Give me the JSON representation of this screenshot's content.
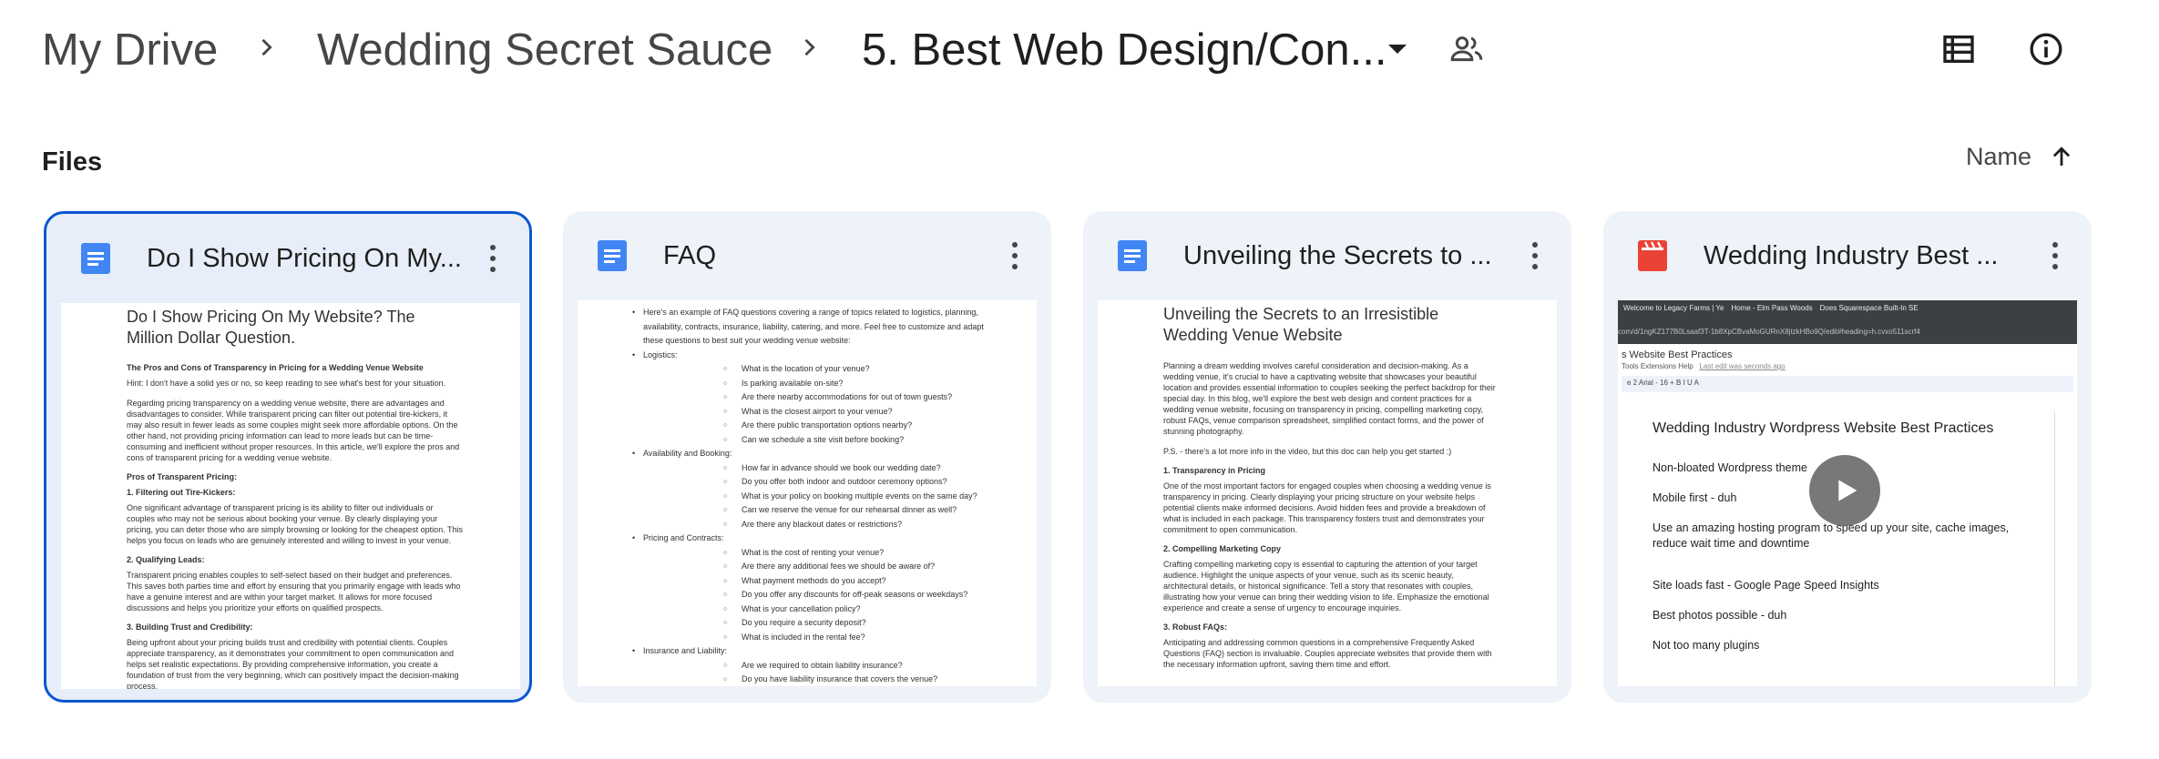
{
  "breadcrumb": {
    "items": [
      "My Drive",
      "Wedding Secret Sauce",
      "5. Best Web Design/Con..."
    ]
  },
  "section": {
    "files_label": "Files",
    "sort_label": "Name"
  },
  "icons": {
    "separator": "chevron-right-icon",
    "dropdown": "arrow-drop-down-icon",
    "shared": "people-icon",
    "list_view": "list-view-icon",
    "info": "info-icon",
    "sort_dir": "arrow-upward-icon",
    "doc": "google-docs-icon",
    "video": "video-clapper-icon",
    "more": "more-vert-icon",
    "play": "play-icon"
  },
  "colors": {
    "docs_blue": "#4285f4",
    "video_red": "#ea4335",
    "selected_border": "#0b57d0",
    "card_bg": "#eef2f9"
  },
  "cards": [
    {
      "title": "Do I Show Pricing On My...",
      "preview": {
        "title": "Do I Show Pricing On My Website? The Million Dollar Question.",
        "blocks": [
          {
            "type": "h",
            "text": "The Pros and Cons of Transparency in Pricing for a Wedding Venue Website"
          },
          {
            "type": "p",
            "text": "Hint: I don't have a solid yes or no, so keep reading to see what's best for your situation."
          },
          {
            "type": "p",
            "text": "Regarding pricing transparency on a wedding venue website, there are advantages and disadvantages to consider. While transparent pricing can filter out potential tire-kickers, it may also result in fewer leads as some couples might seek more affordable options. On the other hand, not providing pricing information can lead to more leads but can be time-consuming and inefficient without proper resources. In this article, we'll explore the pros and cons of transparent pricing for a wedding venue website."
          },
          {
            "type": "h",
            "text": "Pros of Transparent Pricing:"
          },
          {
            "type": "h",
            "text": "1. Filtering out Tire-Kickers:"
          },
          {
            "type": "p",
            "text": "One significant advantage of transparent pricing is its ability to filter out individuals or couples who may not be serious about booking your venue. By clearly displaying your pricing, you can deter those who are simply browsing or looking for the cheapest option. This helps you focus on leads who are genuinely interested and willing to invest in your venue."
          },
          {
            "type": "h",
            "text": "2. Qualifying Leads:"
          },
          {
            "type": "p",
            "text": "Transparent pricing enables couples to self-select based on their budget and preferences. This saves both parties time and effort by ensuring that you primarily engage with leads who have a genuine interest and are within your target market. It allows for more focused discussions and helps you prioritize your efforts on qualified prospects."
          },
          {
            "type": "h",
            "text": "3. Building Trust and Credibility:"
          },
          {
            "type": "p",
            "text": "Being upfront about your pricing builds trust and credibility with potential clients. Couples appreciate transparency, as it demonstrates your commitment to open communication and helps set realistic expectations. By providing comprehensive information, you create a foundation of trust from the very beginning, which can positively impact the decision-making process."
          }
        ]
      }
    },
    {
      "title": "FAQ",
      "preview": {
        "lines": [
          {
            "lvl": 0,
            "text": "Here's an example of FAQ questions covering a range of topics related to logistics, planning, availability, contracts, insurance, liability, catering, and more. Feel free to customize and adapt these questions to best suit your wedding venue website:"
          },
          {
            "lvl": 0,
            "text": "Logistics:"
          },
          {
            "lvl": 1,
            "text": "What is the location of your venue?"
          },
          {
            "lvl": 1,
            "text": "Is parking available on-site?"
          },
          {
            "lvl": 1,
            "text": "Are there nearby accommodations for out of town guests?"
          },
          {
            "lvl": 1,
            "text": "What is the closest airport to your venue?"
          },
          {
            "lvl": 1,
            "text": "Are there public transportation options nearby?"
          },
          {
            "lvl": 1,
            "text": "Can we schedule a site visit before booking?"
          },
          {
            "lvl": 0,
            "text": "Availability and Booking:"
          },
          {
            "lvl": 1,
            "text": "How far in advance should we book our wedding date?"
          },
          {
            "lvl": 1,
            "text": "Do you offer both indoor and outdoor ceremony options?"
          },
          {
            "lvl": 1,
            "text": "What is your policy on booking multiple events on the same day?"
          },
          {
            "lvl": 1,
            "text": "Can we reserve the venue for our rehearsal dinner as well?"
          },
          {
            "lvl": 1,
            "text": "Are there any blackout dates or restrictions?"
          },
          {
            "lvl": 0,
            "text": "Pricing and Contracts:"
          },
          {
            "lvl": 1,
            "text": "What is the cost of renting your venue?"
          },
          {
            "lvl": 1,
            "text": "Are there any additional fees we should be aware of?"
          },
          {
            "lvl": 1,
            "text": "What payment methods do you accept?"
          },
          {
            "lvl": 1,
            "text": "Do you offer any discounts for off-peak seasons or weekdays?"
          },
          {
            "lvl": 1,
            "text": "What is your cancellation policy?"
          },
          {
            "lvl": 1,
            "text": "Do you require a security deposit?"
          },
          {
            "lvl": 1,
            "text": "What is included in the rental fee?"
          },
          {
            "lvl": 0,
            "text": "Insurance and Liability:"
          },
          {
            "lvl": 1,
            "text": "Are we required to obtain liability insurance?"
          },
          {
            "lvl": 1,
            "text": "Do you have liability insurance that covers the venue?"
          }
        ]
      }
    },
    {
      "title": "Unveiling the Secrets to ...",
      "preview": {
        "title": "Unveiling the Secrets to an Irresistible Wedding Venue Website",
        "blocks": [
          {
            "type": "p",
            "text": "Planning a dream wedding involves careful consideration and decision-making. As a wedding venue, it's crucial to have a captivating website that showcases your beautiful location and provides essential information to couples seeking the perfect backdrop for their special day. In this blog, we'll explore the best web design and content practices for a wedding venue website, focusing on transparency in pricing, compelling marketing copy, robust FAQs, venue comparison spreadsheet, simplified contact forms, and the power of stunning photography."
          },
          {
            "type": "p",
            "text": "P.S. - there's a lot more info in the video, but this doc can help you get started :)"
          },
          {
            "type": "h",
            "text": "1. Transparency in Pricing"
          },
          {
            "type": "p",
            "text": "One of the most important factors for engaged couples when choosing a wedding venue is transparency in pricing. Clearly displaying your pricing structure on your website helps potential clients make informed decisions. Avoid hidden fees and provide a breakdown of what is included in each package. This transparency fosters trust and demonstrates your commitment to open communication."
          },
          {
            "type": "h",
            "text": "2. Compelling Marketing Copy"
          },
          {
            "type": "p",
            "text": "Crafting compelling marketing copy is essential to capturing the attention of your target audience. Highlight the unique aspects of your venue, such as its scenic beauty, architectural details, or historical significance. Tell a story that resonates with couples, illustrating how your venue can bring their wedding vision to life. Emphasize the emotional experience and create a sense of urgency to encourage inquiries."
          },
          {
            "type": "h",
            "text": "3. Robust FAQs:"
          },
          {
            "type": "p",
            "text": "Anticipating and addressing common questions in a comprehensive Frequently Asked Questions (FAQ) section is invaluable. Couples appreciate websites that provide them with the necessary information upfront, saving them time and effort."
          }
        ]
      }
    },
    {
      "title": "Wedding Industry Best ...",
      "preview": {
        "tabs": [
          "Welcome to Legacy Farms | Ye",
          "Home - Elm Pass Woods",
          "Does Squarespace Built-In SE"
        ],
        "url": "com/d/1ngKZ177B0Lsaaf3T-1b8XpCBvaMoGURnX8jtzkHBo9Q/edit#heading=h.cvxo511scrf4",
        "doc_title": "s Website Best Practices",
        "menu": "Tools   Extensions   Help",
        "last_edit": "Last edit was seconds ago",
        "toolbar": "e 2   Arial   -  16  +   B  I  U  A",
        "heading": "Wedding Industry Wordpress Website Best Practices",
        "items": [
          "Non-bloated Wordpress theme",
          "Mobile first - duh",
          "Use an amazing hosting program to speed up your site, cache images, reduce wait time and downtime",
          "Site loads fast - Google Page Speed Insights",
          "Best photos possible - duh",
          "Not too many plugins"
        ]
      }
    }
  ]
}
